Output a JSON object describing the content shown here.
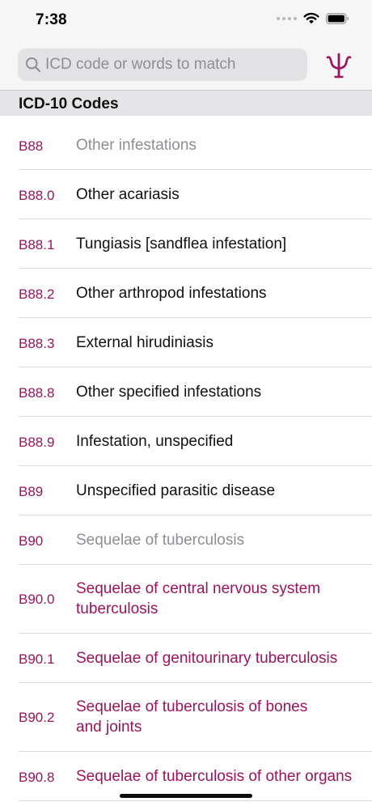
{
  "status_bar": {
    "time": "7:38"
  },
  "search": {
    "placeholder": "ICD code or words to match",
    "value": ""
  },
  "section": {
    "title": "ICD-10 Codes"
  },
  "colors": {
    "accent": "#9e135e",
    "category_text": "#8e8e93",
    "separator": "#dcdcdf"
  },
  "rows": [
    {
      "code": "B88",
      "description": "Other infestations",
      "style": "category"
    },
    {
      "code": "B88.0",
      "description": "Other acariasis",
      "style": "normal"
    },
    {
      "code": "B88.1",
      "description": "Tungiasis [sandflea infestation]",
      "style": "normal"
    },
    {
      "code": "B88.2",
      "description": "Other arthropod infestations",
      "style": "normal"
    },
    {
      "code": "B88.3",
      "description": "External hirudiniasis",
      "style": "normal"
    },
    {
      "code": "B88.8",
      "description": "Other specified infestations",
      "style": "normal"
    },
    {
      "code": "B88.9",
      "description": "Infestation, unspecified",
      "style": "normal"
    },
    {
      "code": "B89",
      "description": "Unspecified parasitic disease",
      "style": "normal"
    },
    {
      "code": "B90",
      "description": "Sequelae of tuberculosis",
      "style": "category"
    },
    {
      "code": "B90.0",
      "description": "Sequelae of central nervous system\ntuberculosis",
      "style": "link"
    },
    {
      "code": "B90.1",
      "description": "Sequelae of genitourinary tuberculosis",
      "style": "link"
    },
    {
      "code": "B90.2",
      "description": "Sequelae of tuberculosis of bones\nand joints",
      "style": "link"
    },
    {
      "code": "B90.8",
      "description": "Sequelae of tuberculosis of other organs",
      "style": "link"
    }
  ]
}
